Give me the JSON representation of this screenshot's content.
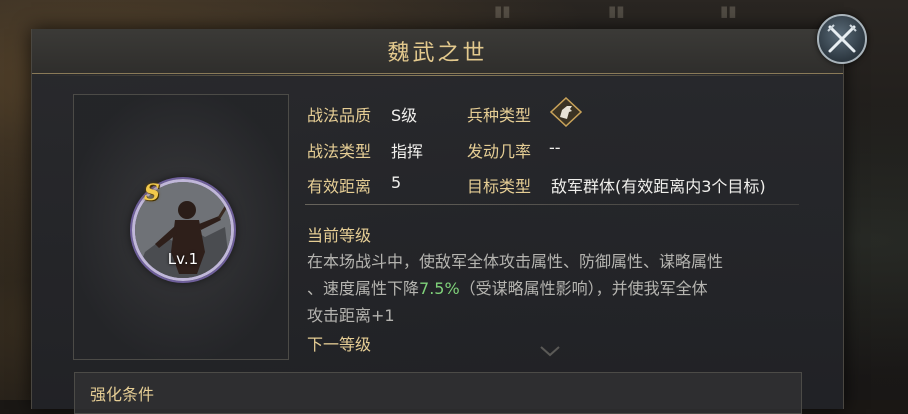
{
  "panel": {
    "title": "魏武之世"
  },
  "skill_icon": {
    "grade": "S",
    "level": "Lv.1"
  },
  "info": {
    "quality_label": "战法品质",
    "quality_value": "S级",
    "troop_label": "兵种类型",
    "troop_icon": "cavalry-horse-icon",
    "type_label": "战法类型",
    "type_value": "指挥",
    "rate_label": "发动几率",
    "rate_value": "--",
    "range_label": "有效距离",
    "range_value": "5",
    "target_label": "目标类型",
    "target_value": "敌军群体(有效距离内3个目标)"
  },
  "current_level": {
    "title": "当前等级",
    "desc_line1": "在本场战斗中，使敌军全体攻击属性、防御属性、谋略属性",
    "desc_line2_pre": "、速度属性下降",
    "desc_line2_value": "7.5%",
    "desc_line2_post": "（受谋略属性影响），并使我军全体",
    "desc_line3": "攻击距离+1"
  },
  "next_level": {
    "title": "下一等级"
  },
  "enhance": {
    "title": "强化条件"
  },
  "colors": {
    "title_gold": "#e3c98d",
    "label_gold": "#e5cd94",
    "highlight_green": "#7fd17a"
  }
}
